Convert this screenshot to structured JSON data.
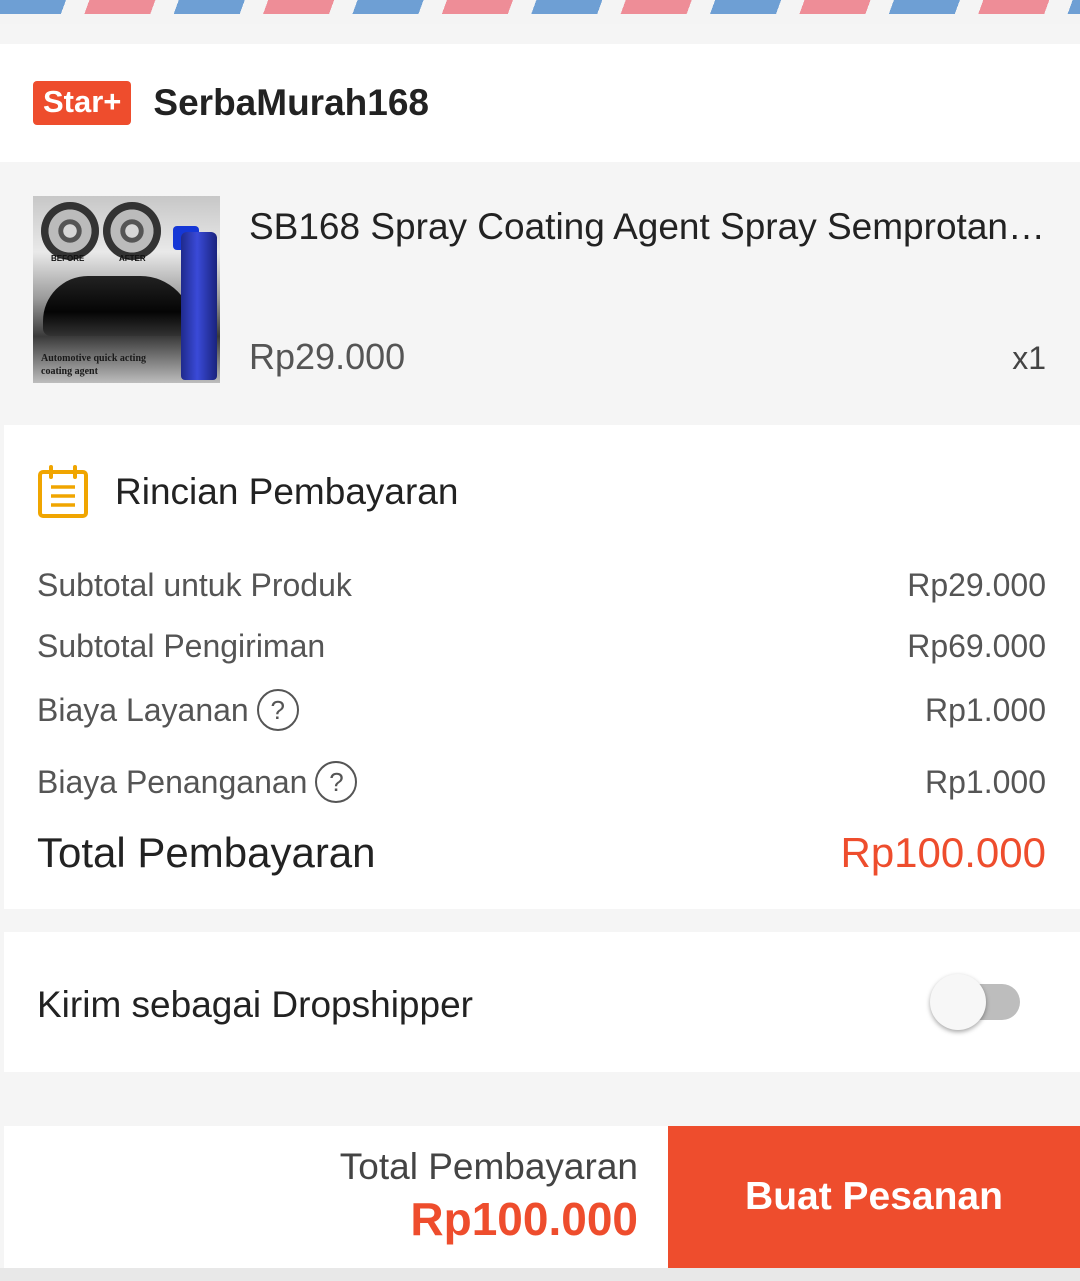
{
  "colors": {
    "accent": "#ee4d2d",
    "stripe_blue": "#6e9fd4",
    "stripe_pink": "#ee8d97",
    "calendar_icon": "#f0a500"
  },
  "shop": {
    "badge": "Star+",
    "name": "SerbaMurah168"
  },
  "product": {
    "title": "SB168 Spray Coating Agent Spray Semprotan",
    "price": "Rp29.000",
    "quantity": "x1",
    "thumbnail": {
      "before_label": "BEFORE",
      "after_label": "AFTER",
      "caption": "Automotive quick acting coating agent"
    }
  },
  "payment": {
    "icon": "calendar-list-icon",
    "title": "Rincian Pembayaran",
    "rows": [
      {
        "label": "Subtotal untuk Produk",
        "value": "Rp29.000"
      },
      {
        "label": "Subtotal Pengiriman",
        "value": "Rp69.000"
      },
      {
        "label": "Biaya Layanan",
        "value": "Rp1.000"
      },
      {
        "label": "Biaya Penanganan",
        "value": "Rp1.000"
      }
    ],
    "help_glyph": "?",
    "total_label": "Total Pembayaran",
    "total_value": "Rp100.000"
  },
  "dropshipper": {
    "label": "Kirim sebagai Dropshipper",
    "enabled": false
  },
  "bottom_bar": {
    "total_label": "Total Pembayaran",
    "total_value": "Rp100.000",
    "button_label": "Buat Pesanan"
  }
}
